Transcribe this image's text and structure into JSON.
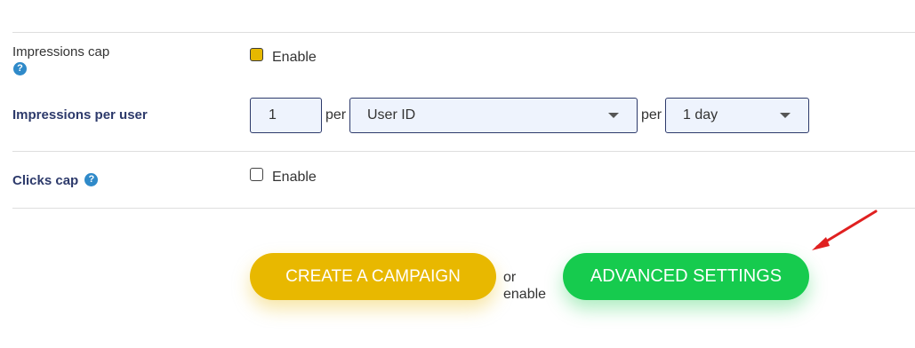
{
  "impressions_cap": {
    "label": "Impressions cap",
    "help_glyph": "?",
    "checkbox_checked": true,
    "checkbox_label": "Enable"
  },
  "impressions_per_user": {
    "label": "Impressions per user",
    "count_value": "1",
    "per_label_1": "per",
    "per_select_value": "User ID",
    "per_label_2": "per",
    "period_select_value": "1 day"
  },
  "clicks_cap": {
    "label": "Clicks cap",
    "help_glyph": "?",
    "checkbox_checked": false,
    "checkbox_label": "Enable"
  },
  "actions": {
    "create_label": "CREATE A CAMPAIGN",
    "or_line1": "or",
    "or_line2": "enable",
    "advanced_label": "ADVANCED SETTINGS"
  },
  "colors": {
    "accent_yellow": "#e8b800",
    "accent_green": "#16cb4e",
    "label_navy": "#2d3a6b",
    "help_blue": "#2f8ac9",
    "annotation_red": "#e02020"
  },
  "icons": [
    "help-icon",
    "chevron-down-icon",
    "arrow-annotation"
  ]
}
